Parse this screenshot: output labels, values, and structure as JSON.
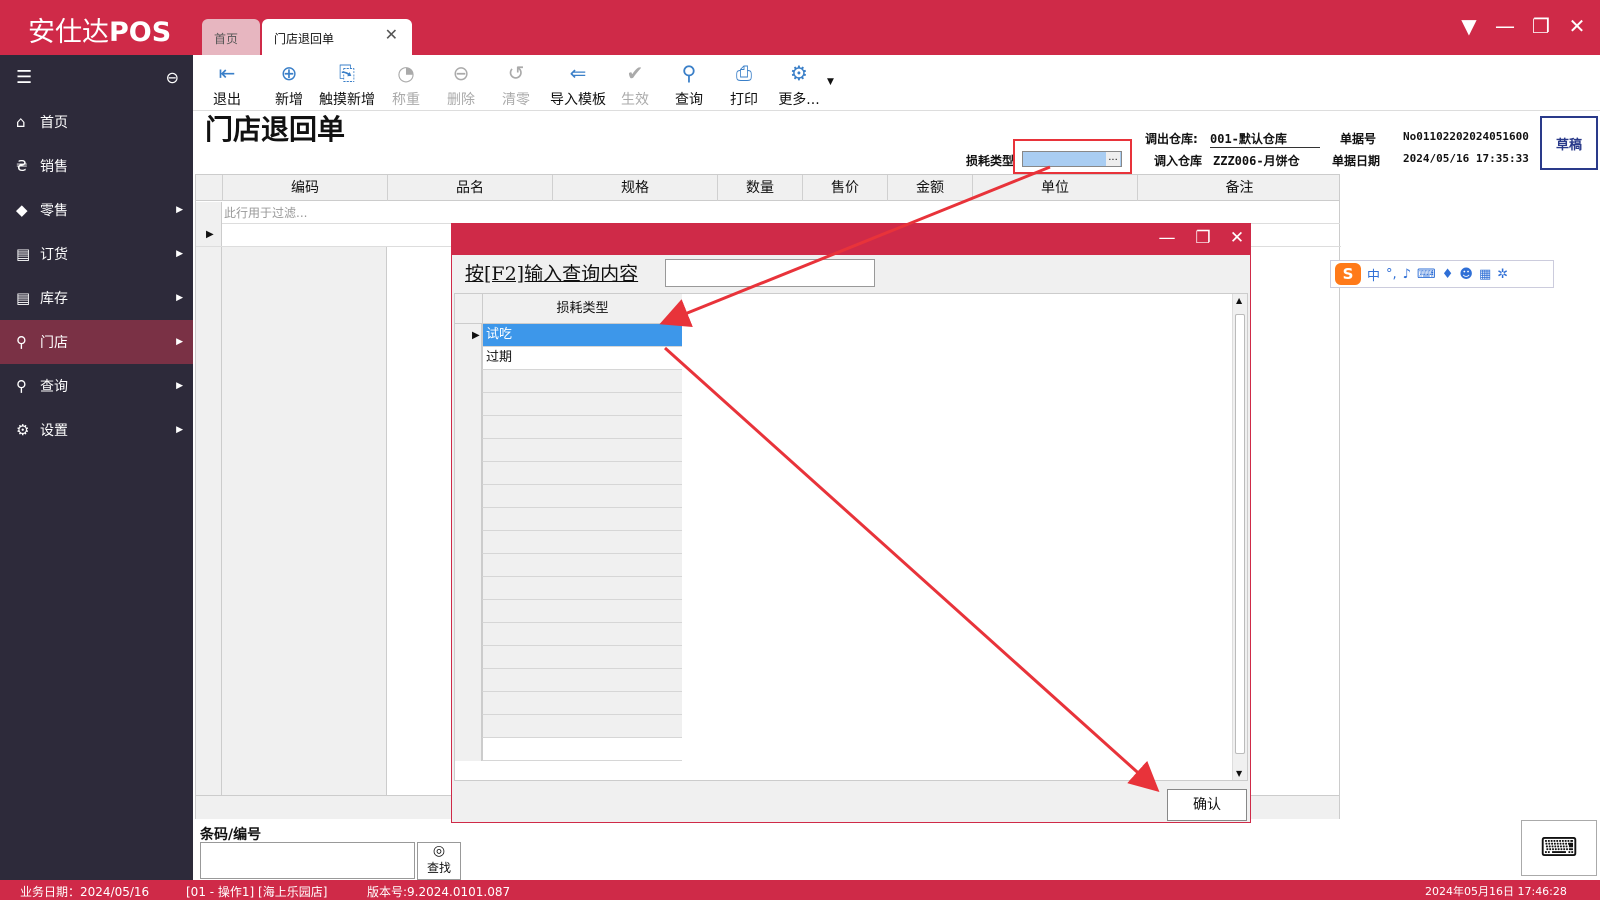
{
  "app": {
    "brand_cn": "安仕达",
    "brand_en": "POS"
  },
  "tabs": [
    {
      "label": "首页"
    },
    {
      "label": "门店退回单"
    }
  ],
  "sidebar": {
    "items": [
      {
        "label": "首页",
        "icon": "home-icon",
        "has_arrow": false
      },
      {
        "label": "销售",
        "icon": "currency-icon",
        "has_arrow": false
      },
      {
        "label": "零售",
        "icon": "tag-icon",
        "has_arrow": true
      },
      {
        "label": "订货",
        "icon": "database-icon",
        "has_arrow": true
      },
      {
        "label": "库存",
        "icon": "database-icon",
        "has_arrow": true
      },
      {
        "label": "门店",
        "icon": "search-icon",
        "has_arrow": true,
        "active": true
      },
      {
        "label": "查询",
        "icon": "search-icon",
        "has_arrow": true
      },
      {
        "label": "设置",
        "icon": "gear-icon",
        "has_arrow": true
      }
    ]
  },
  "toolbar": {
    "buttons": [
      {
        "label": "退出",
        "icon": "exit-icon",
        "enabled": true
      },
      {
        "label": "新增",
        "icon": "plus-circle-icon",
        "enabled": true
      },
      {
        "label": "触摸新增",
        "icon": "doc-add-icon",
        "enabled": true
      },
      {
        "label": "称重",
        "icon": "scale-icon",
        "enabled": false
      },
      {
        "label": "删除",
        "icon": "minus-circle-icon",
        "enabled": false
      },
      {
        "label": "清零",
        "icon": "reset-icon",
        "enabled": false
      },
      {
        "label": "导入模板",
        "icon": "import-icon",
        "enabled": true
      },
      {
        "label": "生效",
        "icon": "check-circle-icon",
        "enabled": false
      },
      {
        "label": "查询",
        "icon": "search-icon",
        "enabled": true
      },
      {
        "label": "打印",
        "icon": "printer-icon",
        "enabled": true
      },
      {
        "label": "更多...",
        "icon": "gear-icon",
        "enabled": true
      }
    ]
  },
  "document": {
    "title": "门店退回单",
    "out_warehouse_label": "调出仓库:",
    "out_warehouse_value": "001-默认仓库",
    "in_warehouse_label": "调入仓库",
    "in_warehouse_value": "ZZZ006-月饼仓",
    "order_no_label": "单据号",
    "order_no_value": "No01102202024051600",
    "order_date_label": "单据日期",
    "order_date_value": "2024/05/16 17:35:33",
    "loss_type_label": "损耗类型",
    "loss_type_value": "",
    "status": "草稿"
  },
  "grid": {
    "columns": [
      "编码",
      "品名",
      "规格",
      "数量",
      "售价",
      "金额",
      "单位",
      "备注"
    ],
    "filter_placeholder": "此行用于过滤..."
  },
  "bottom": {
    "barcode_label": "条码/编号",
    "find_label": "查找"
  },
  "statusbar": {
    "business_date": "业务日期：2024/05/16",
    "operator": "[01 - 操作1]  [海上乐园店]",
    "version": "版本号:9.2024.0101.087",
    "datetime": "2024年05月16日 17:46:28"
  },
  "dialog": {
    "search_label": "按[F2]输入查询内容",
    "search_value": "",
    "column": "损耗类型",
    "rows": [
      "试吃",
      "过期"
    ],
    "selected_index": 0,
    "confirm_label": "确认"
  },
  "ime": {
    "logo": "S",
    "mode": "中"
  },
  "colors": {
    "brand": "#cf2a48",
    "sidebar": "#2d2a3a",
    "selection": "#3d97ea",
    "annotation": "#e8333a"
  }
}
